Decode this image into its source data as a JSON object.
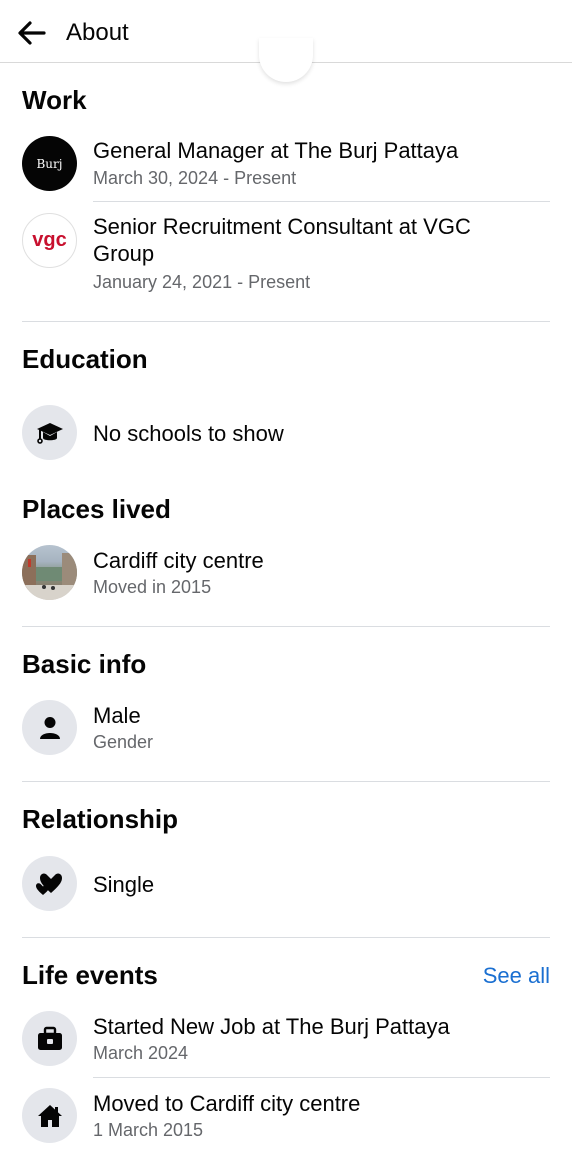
{
  "header": {
    "title": "About"
  },
  "work": {
    "heading": "Work",
    "items": [
      {
        "title": "General Manager at The Burj Pattaya",
        "subtitle": "March 30, 2024 - Present",
        "logo_text": "Burj"
      },
      {
        "title": "Senior Recruitment Consultant at VGC Group",
        "subtitle": "January 24, 2021 - Present",
        "logo_text": "vgc"
      }
    ]
  },
  "education": {
    "heading": "Education",
    "empty_text": "No schools to show"
  },
  "places": {
    "heading": "Places lived",
    "items": [
      {
        "title": "Cardiff city centre",
        "subtitle": "Moved in 2015"
      }
    ]
  },
  "basic_info": {
    "heading": "Basic info",
    "items": [
      {
        "title": "Male",
        "subtitle": "Gender"
      }
    ]
  },
  "relationship": {
    "heading": "Relationship",
    "status": "Single"
  },
  "life_events": {
    "heading": "Life events",
    "see_all": "See all",
    "items": [
      {
        "title": "Started New Job at The Burj Pattaya",
        "subtitle": "March 2024"
      },
      {
        "title": "Moved to Cardiff city centre",
        "subtitle": "1 March 2015"
      }
    ]
  },
  "colors": {
    "link": "#1a6fd1",
    "secondary_text": "#65676b",
    "icon_bg": "#e4e6eb"
  }
}
